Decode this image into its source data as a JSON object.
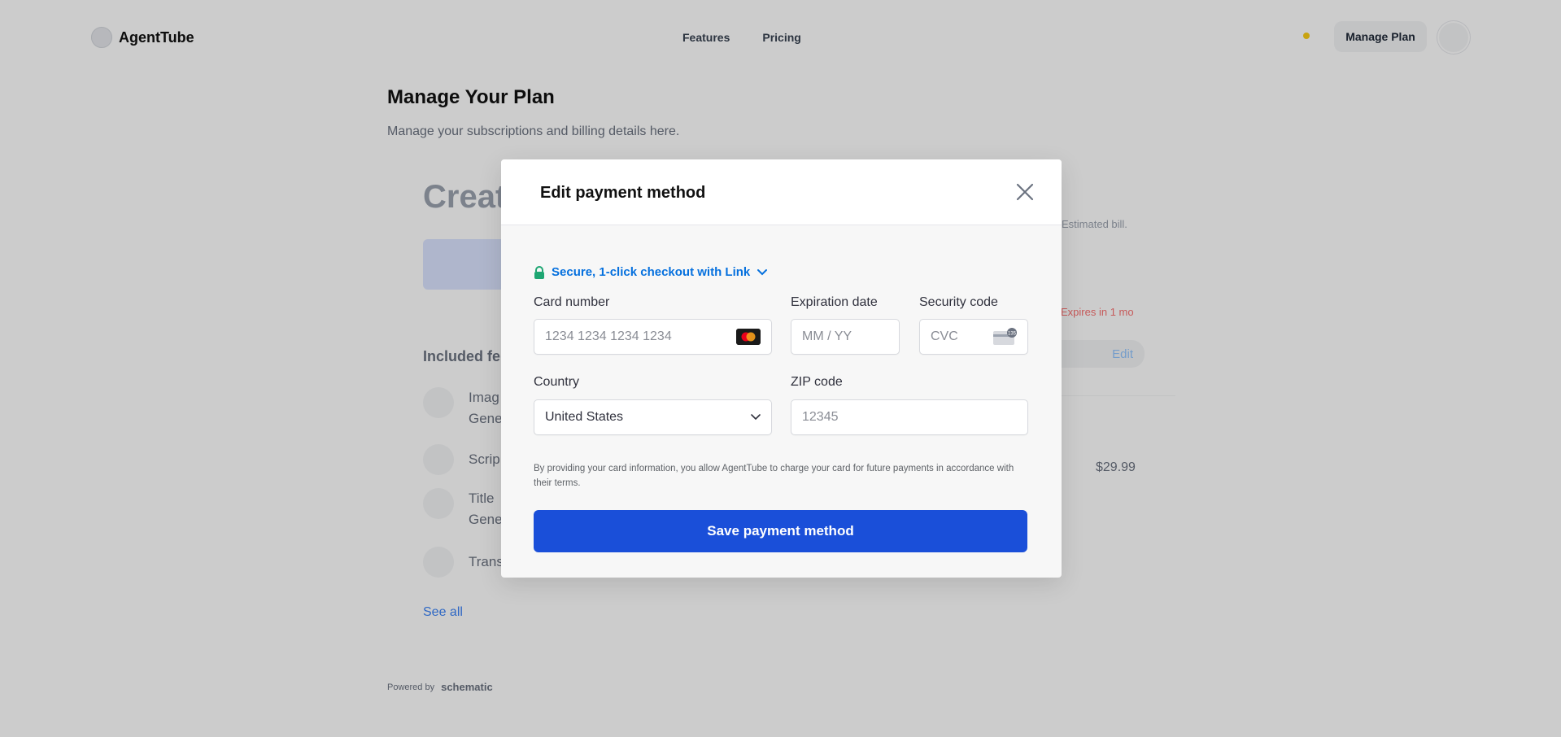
{
  "app": {
    "name": "AgentTube"
  },
  "nav": {
    "links": [
      "Features",
      "Pricing"
    ],
    "manage_plan": "Manage Plan"
  },
  "page": {
    "title": "Manage Your Plan",
    "subtitle": "Manage your subscriptions and billing details here.",
    "left_card": {
      "heading": "Creat",
      "included_heading": "Included fe",
      "features": [
        {
          "line1": "Imag",
          "line2": "Gene"
        },
        {
          "line1": "Scrip",
          "line2": ""
        },
        {
          "line1": "Title",
          "line2": "Gene"
        },
        {
          "line1": "Trans",
          "line2": ""
        }
      ],
      "see_all": "See all"
    },
    "right_card": {
      "estimated_bill": "Estimated bill.",
      "expires": "Expires in 1 mo",
      "edit": "Edit",
      "price": "$29.99"
    },
    "powered_by": "Powered by",
    "powered_brand": "schematic"
  },
  "modal": {
    "title": "Edit payment method",
    "link_text": "Secure, 1-click checkout with Link",
    "card_number": {
      "label": "Card number",
      "placeholder": "1234 1234 1234 1234"
    },
    "expiration": {
      "label": "Expiration date",
      "placeholder": "MM / YY"
    },
    "security": {
      "label": "Security code",
      "placeholder": "CVC"
    },
    "country": {
      "label": "Country",
      "value": "United States"
    },
    "zip": {
      "label": "ZIP code",
      "placeholder": "12345"
    },
    "terms": "By providing your card information, you allow AgentTube to charge your card for future payments in accordance with their terms.",
    "save_label": "Save payment method"
  },
  "icons": {
    "close": "close-icon",
    "lock": "lock-icon",
    "chevron": "chevron-down-icon",
    "card_brand": "mastercard-icon",
    "cvc": "cvc-card-icon"
  },
  "colors": {
    "primary": "#1a4fd9",
    "link": "#0570de",
    "lock": "#1ea672"
  }
}
